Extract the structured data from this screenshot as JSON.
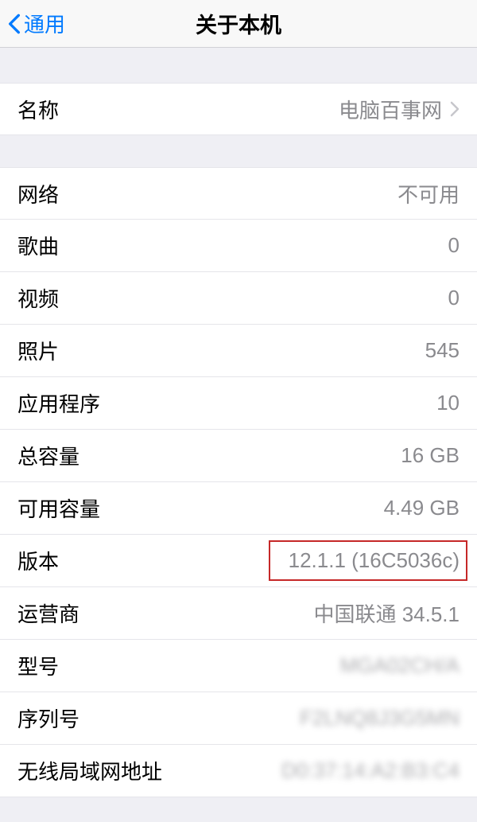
{
  "header": {
    "back_label": "通用",
    "title": "关于本机"
  },
  "name_section": {
    "label": "名称",
    "value": "电脑百事网"
  },
  "info_rows": [
    {
      "label": "网络",
      "value": "不可用",
      "blur": false
    },
    {
      "label": "歌曲",
      "value": "0",
      "blur": false
    },
    {
      "label": "视频",
      "value": "0",
      "blur": false
    },
    {
      "label": "照片",
      "value": "545",
      "blur": false
    },
    {
      "label": "应用程序",
      "value": "10",
      "blur": false
    },
    {
      "label": "总容量",
      "value": "16 GB",
      "blur": false
    },
    {
      "label": "可用容量",
      "value": "4.49 GB",
      "blur": false
    },
    {
      "label": "版本",
      "value": "12.1.1 (16C5036c)",
      "blur": false,
      "highlight": true
    },
    {
      "label": "运营商",
      "value": "中国联通 34.5.1",
      "blur": false
    },
    {
      "label": "型号",
      "value": "MGA02CH/A",
      "blur": true
    },
    {
      "label": "序列号",
      "value": "F2LNQ8J3G5MN",
      "blur": true
    },
    {
      "label": "无线局域网地址",
      "value": "D0:37:14:A2:B3:C4",
      "blur": true
    }
  ]
}
